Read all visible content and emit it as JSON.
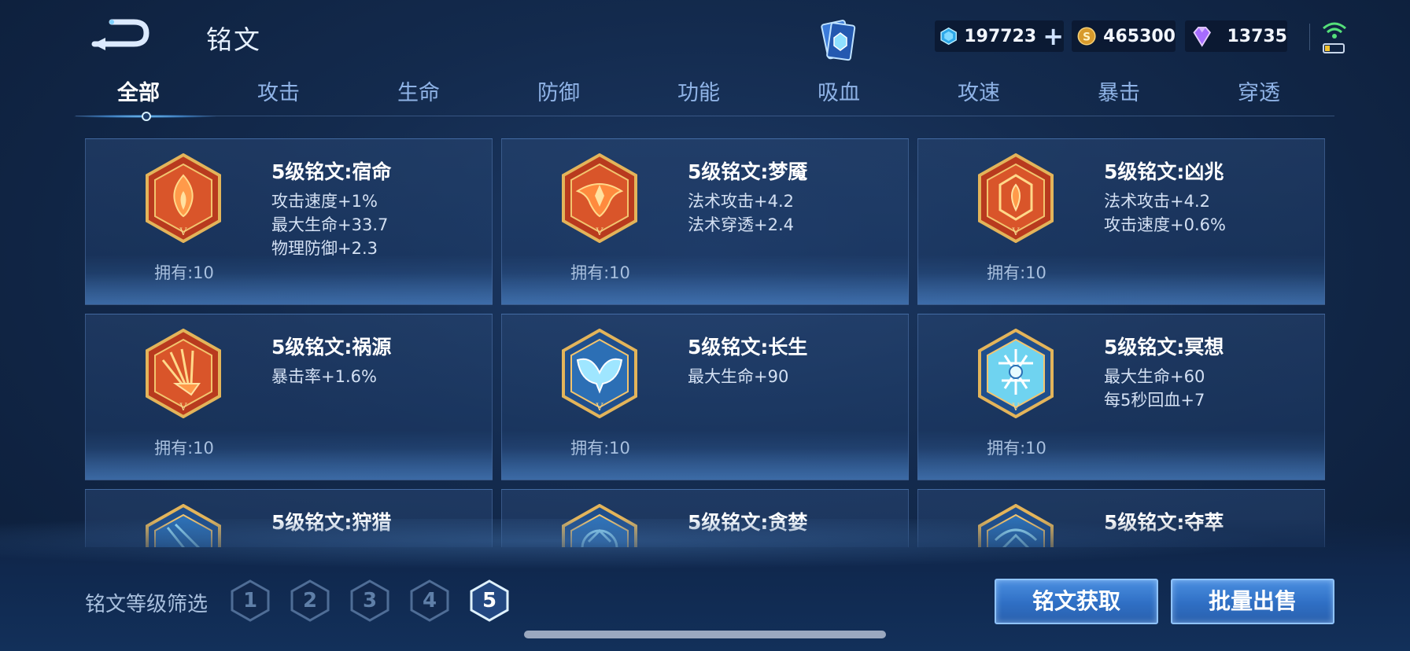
{
  "header": {
    "title": "铭文",
    "back_icon": "back-arrow-icon",
    "currencies": [
      {
        "icon": "crystal-gem-icon",
        "value": "197723",
        "has_plus": true,
        "color": "#4fc3f7"
      },
      {
        "icon": "gold-coin-icon",
        "value": "465300",
        "color": "#e0a83a"
      },
      {
        "icon": "purple-diamond-icon",
        "value": "13735",
        "color": "#b47cff"
      }
    ]
  },
  "tabs": [
    {
      "label": "全部",
      "active": true
    },
    {
      "label": "攻击"
    },
    {
      "label": "生命"
    },
    {
      "label": "防御"
    },
    {
      "label": "功能"
    },
    {
      "label": "吸血"
    },
    {
      "label": "攻速"
    },
    {
      "label": "暴击"
    },
    {
      "label": "穿透"
    }
  ],
  "runes": [
    {
      "name": "5级铭文:宿命",
      "stats": [
        "攻击速度+1%",
        "最大生命+33.7",
        "物理防御+2.3"
      ],
      "owned": "拥有:10",
      "color": "red",
      "icon": "flame-rune-icon"
    },
    {
      "name": "5级铭文:梦魇",
      "stats": [
        "法术攻击+4.2",
        "法术穿透+2.4"
      ],
      "owned": "拥有:10",
      "color": "red",
      "icon": "nightmare-rune-icon"
    },
    {
      "name": "5级铭文:凶兆",
      "stats": [
        "法术攻击+4.2",
        "攻击速度+0.6%"
      ],
      "owned": "拥有:10",
      "color": "red",
      "icon": "omen-rune-icon"
    },
    {
      "name": "5级铭文:祸源",
      "stats": [
        "暴击率+1.6%"
      ],
      "owned": "拥有:10",
      "color": "red",
      "icon": "calamity-rune-icon"
    },
    {
      "name": "5级铭文:长生",
      "stats": [
        "最大生命+90"
      ],
      "owned": "拥有:10",
      "color": "blue",
      "icon": "longevity-rune-icon"
    },
    {
      "name": "5级铭文:冥想",
      "stats": [
        "最大生命+60",
        "每5秒回血+7"
      ],
      "owned": "拥有:10",
      "color": "blue",
      "icon": "meditation-rune-icon"
    },
    {
      "name": "5级铭文:狩猎",
      "stats": [],
      "owned": "",
      "color": "blue",
      "icon": "hunting-rune-icon"
    },
    {
      "name": "5级铭文:贪婪",
      "stats": [],
      "owned": "",
      "color": "blue",
      "icon": "greed-rune-icon"
    },
    {
      "name": "5级铭文:夺萃",
      "stats": [],
      "owned": "",
      "color": "blue",
      "icon": "plunder-rune-icon"
    }
  ],
  "filter": {
    "label": "铭文等级筛选",
    "levels": [
      "1",
      "2",
      "3",
      "4",
      "5"
    ],
    "active": "5"
  },
  "buttons": {
    "get": "铭文获取",
    "sell": "批量出售"
  }
}
